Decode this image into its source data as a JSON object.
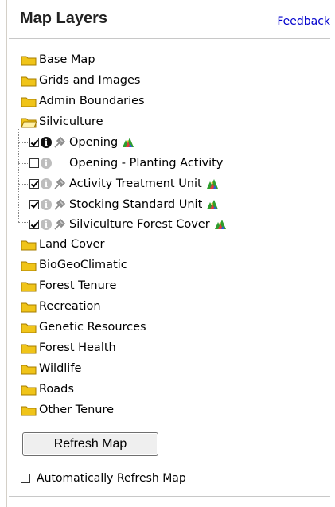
{
  "header": {
    "title": "Map Layers",
    "feedback_label": "Feedback"
  },
  "layers": [
    {
      "label": "Base Map"
    },
    {
      "label": "Grids and Images"
    },
    {
      "label": "Admin Boundaries"
    },
    {
      "label": "Silviculture",
      "expanded": true,
      "children": [
        {
          "label": "Opening",
          "checked": true,
          "info": "dark",
          "tool": true,
          "legend": true
        },
        {
          "label": "Opening - Planting Activity",
          "checked": false,
          "info": "light",
          "tool": false,
          "legend": false
        },
        {
          "label": "Activity Treatment Unit",
          "checked": true,
          "info": "light",
          "tool": true,
          "legend": true
        },
        {
          "label": "Stocking Standard Unit",
          "checked": true,
          "info": "light",
          "tool": true,
          "legend": true
        },
        {
          "label": "Silviculture Forest Cover",
          "checked": true,
          "info": "light",
          "tool": true,
          "legend": true
        }
      ]
    },
    {
      "label": "Land Cover"
    },
    {
      "label": "BioGeoClimatic"
    },
    {
      "label": "Forest Tenure"
    },
    {
      "label": "Recreation"
    },
    {
      "label": "Genetic Resources"
    },
    {
      "label": "Forest Health"
    },
    {
      "label": "Wildlife"
    },
    {
      "label": "Roads"
    },
    {
      "label": "Other Tenure"
    }
  ],
  "refresh_button": {
    "label": "Refresh Map"
  },
  "auto_refresh": {
    "label": "Automatically Refresh Map",
    "checked": false
  },
  "colors": {
    "folder": "#f0c419",
    "link": "#0000cc",
    "info_dark": "#111111",
    "info_light": "#bdbdbd"
  },
  "icons": {
    "folder": "folder-icon",
    "open_folder": "folder-open-icon",
    "info": "info-icon",
    "tool": "identify-tool-icon",
    "legend": "legend-icon"
  }
}
